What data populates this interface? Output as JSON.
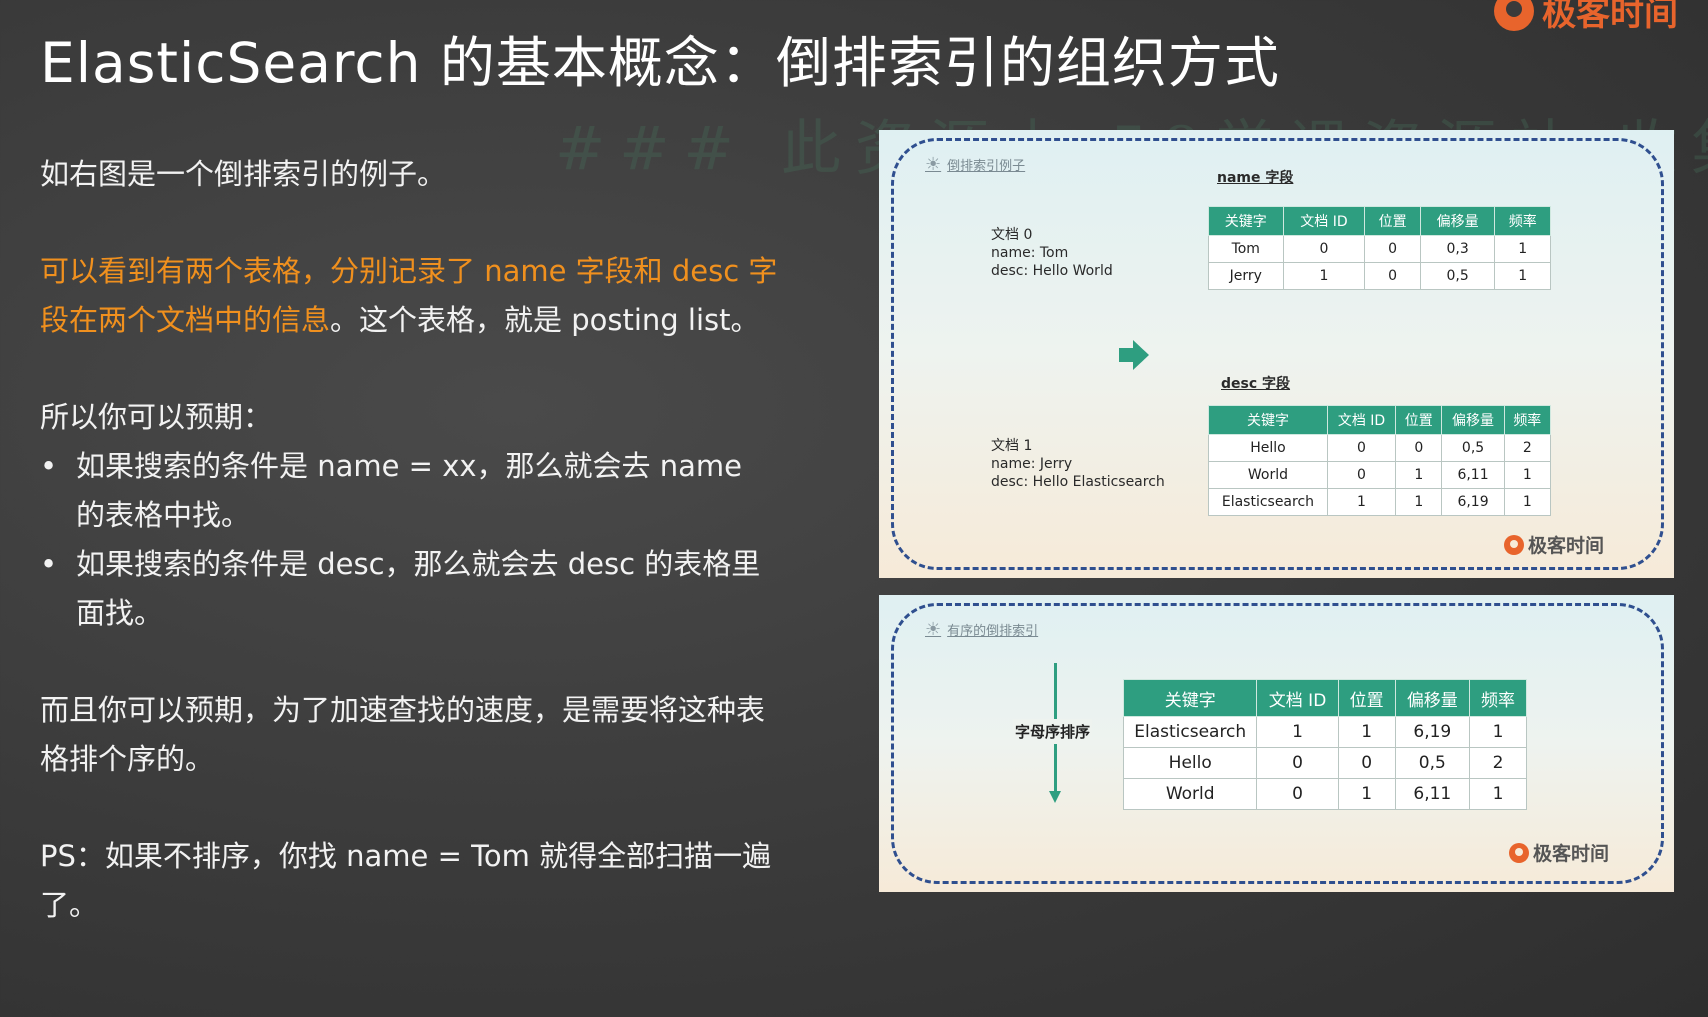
{
  "brand": {
    "name": "极客时间"
  },
  "watermark": {
    "text": "### 此资源由 58学课资源站 收集整"
  },
  "title": "ElasticSearch 的基本概念：倒排索引的组织方式",
  "left": {
    "intro": "如右图是一个倒排索引的例子。",
    "p2_orange": "可以看到有两个表格，分别记录了 name 字段和 desc 字段在两个文档中的信息",
    "p2_rest": "。这个表格，就是 posting list。",
    "p3": "所以你可以预期：",
    "bullets": [
      "如果搜索的条件是 name = xx，那么就会去 name 的表格中找。",
      "如果搜索的条件是 desc，那么就会去 desc 的表格里面找。"
    ],
    "p4": "而且你可以预期，为了加速查找的速度，是需要将这种表格排个序的。",
    "p5": "PS：如果不排序，你找 name = Tom 就得全部扫描一遍了。"
  },
  "panel1": {
    "title": "倒排索引例子",
    "doc0": [
      "文档 0",
      "name: Tom",
      "desc: Hello World"
    ],
    "doc1": [
      "文档 1",
      "name: Jerry",
      "desc: Hello Elasticsearch"
    ],
    "name_label": "name 字段",
    "desc_label": "desc 字段",
    "headers": [
      "关键字",
      "文档 ID",
      "位置",
      "偏移量",
      "频率"
    ],
    "name_rows": [
      [
        "Tom",
        "0",
        "0",
        "0,3",
        "1"
      ],
      [
        "Jerry",
        "1",
        "0",
        "0,5",
        "1"
      ]
    ],
    "desc_rows": [
      [
        "Hello",
        "0",
        "0",
        "0,5",
        "2"
      ],
      [
        "World",
        "0",
        "1",
        "6,11",
        "1"
      ],
      [
        "Elasticsearch",
        "1",
        "1",
        "6,19",
        "1"
      ]
    ],
    "logo_text": "极客时间"
  },
  "panel2": {
    "title": "有序的倒排索引",
    "sort_label": "字母序排序",
    "headers": [
      "关键字",
      "文档 ID",
      "位置",
      "偏移量",
      "频率"
    ],
    "rows": [
      [
        "Elasticsearch",
        "1",
        "1",
        "6,19",
        "1"
      ],
      [
        "Hello",
        "0",
        "0",
        "0,5",
        "2"
      ],
      [
        "World",
        "0",
        "1",
        "6,11",
        "1"
      ]
    ],
    "logo_text": "极客时间"
  },
  "colors": {
    "accent_orange": "#f0901e",
    "table_header": "#2e9e80",
    "brand": "#e8642c"
  }
}
